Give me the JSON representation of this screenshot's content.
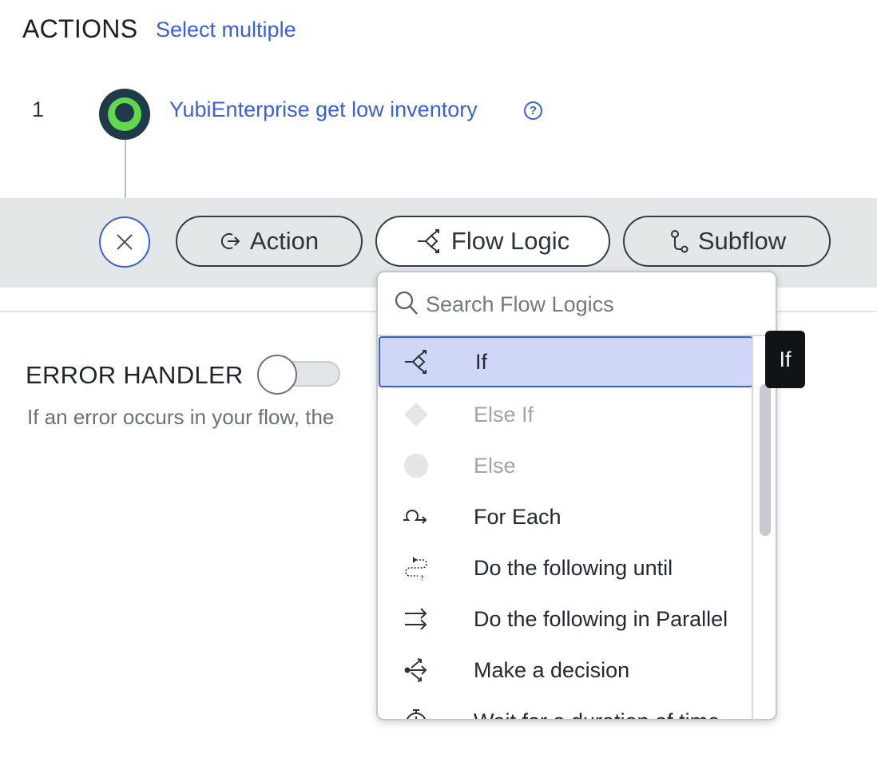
{
  "header": {
    "title": "ACTIONS",
    "select_multiple": "Select multiple"
  },
  "step": {
    "number": "1",
    "label": "YubiEnterprise get low inventory",
    "help_icon": "?"
  },
  "toolbar": {
    "action_label": "Action",
    "flow_logic_label": "Flow Logic",
    "subflow_label": "Subflow",
    "active": "Flow Logic"
  },
  "error_handler": {
    "title": "ERROR HANDLER",
    "enabled": false,
    "description": "If an error occurs in your flow, the"
  },
  "flow_logic_menu": {
    "search_placeholder": "Search Flow Logics",
    "items": [
      {
        "label": "If",
        "icon": "branch-icon",
        "state": "selected"
      },
      {
        "label": "Else If",
        "icon": "diamond-icon",
        "state": "disabled"
      },
      {
        "label": "Else",
        "icon": "circle-icon",
        "state": "disabled"
      },
      {
        "label": "For Each",
        "icon": "loop-icon",
        "state": "enabled"
      },
      {
        "label": "Do the following until",
        "icon": "dotted-loop-icon",
        "state": "enabled"
      },
      {
        "label": "Do the following in Parallel",
        "icon": "parallel-arrows-icon",
        "state": "enabled"
      },
      {
        "label": "Make a decision",
        "icon": "decision-icon",
        "state": "enabled"
      },
      {
        "label": "Wait for a duration of time",
        "icon": "timer-icon",
        "state": "enabled"
      }
    ]
  },
  "tooltip": {
    "text": "If"
  },
  "colors": {
    "accent": "#3a5fd9",
    "selected_bg": "#cfd6f6",
    "band_bg": "#e4e7e8",
    "avatar_dark": "#1f3a48",
    "avatar_green": "#62d84e"
  }
}
